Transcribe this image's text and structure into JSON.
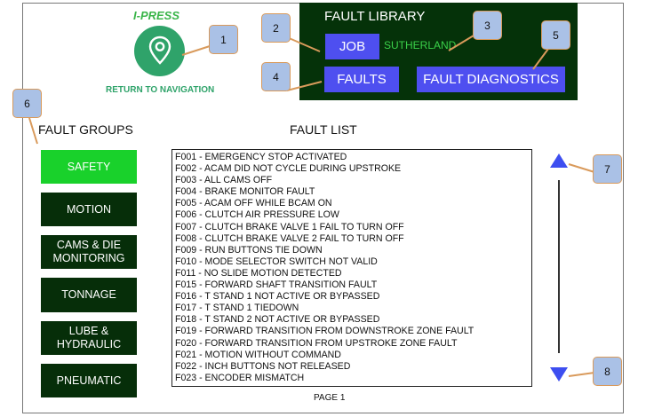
{
  "brand": {
    "title": "I-PRESS",
    "return_label": "RETURN TO NAVIGATION"
  },
  "fault_library": {
    "title": "FAULT LIBRARY",
    "job_button": "JOB",
    "job_value": "SUTHERLAND",
    "faults_button": "FAULTS",
    "diagnostics_button": "FAULT DIAGNOSTICS"
  },
  "fault_groups": {
    "heading": "FAULT GROUPS",
    "items": [
      {
        "label": "SAFETY",
        "active": true
      },
      {
        "label": "MOTION",
        "active": false
      },
      {
        "label": "CAMS & DIE\nMONITORING",
        "active": false
      },
      {
        "label": "TONNAGE",
        "active": false
      },
      {
        "label": "LUBE &\nHYDRAULIC",
        "active": false
      },
      {
        "label": "PNEUMATIC",
        "active": false
      }
    ]
  },
  "fault_list": {
    "heading": "FAULT LIST",
    "items": [
      "F001 - EMERGENCY STOP ACTIVATED",
      "F002 - ACAM DID NOT CYCLE DURING UPSTROKE",
      "F003 - ALL CAMS OFF",
      "F004 - BRAKE MONITOR FAULT",
      "F005 - ACAM OFF WHILE BCAM ON",
      "F006 - CLUTCH AIR PRESSURE LOW",
      "F007 - CLUTCH BRAKE VALVE 1 FAIL TO TURN OFF",
      "F008 - CLUTCH BRAKE VALVE 2 FAIL TO TURN OFF",
      "F009 - RUN BUTTONS TIE DOWN",
      "F010 - MODE SELECTOR SWITCH NOT VALID",
      "F011 - NO SLIDE MOTION DETECTED",
      "F015 - FORWARD SHAFT TRANSITION FAULT",
      "F016 - T STAND 1 NOT ACTIVE OR BYPASSED",
      "F017 - T STAND 1 TIEDOWN",
      "F018 - T STAND 2 NOT ACTIVE OR BYPASSED",
      "F019 - FORWARD TRANSITION FROM DOWNSTROKE ZONE FAULT",
      "F020 - FORWARD TRANSITION FROM UPSTROKE  ZONE FAULT",
      "F021 - MOTION WITHOUT COMMAND",
      "F022 - INCH BUTTONS NOT RELEASED",
      "F023 - ENCODER MISMATCH"
    ],
    "page_label": "PAGE  1"
  },
  "callouts": [
    "1",
    "2",
    "3",
    "4",
    "5",
    "6",
    "7",
    "8"
  ],
  "colors": {
    "library_bg": "#053209",
    "button_blue": "#4e4ff0",
    "group_bg": "#062e09",
    "group_active": "#19d12b",
    "brand_green": "#3bb54a",
    "arrow_blue": "#3d4ef0"
  },
  "icons": {
    "navigation": "map-pin-icon",
    "scroll_up": "triangle-up-icon",
    "scroll_down": "triangle-down-icon"
  }
}
